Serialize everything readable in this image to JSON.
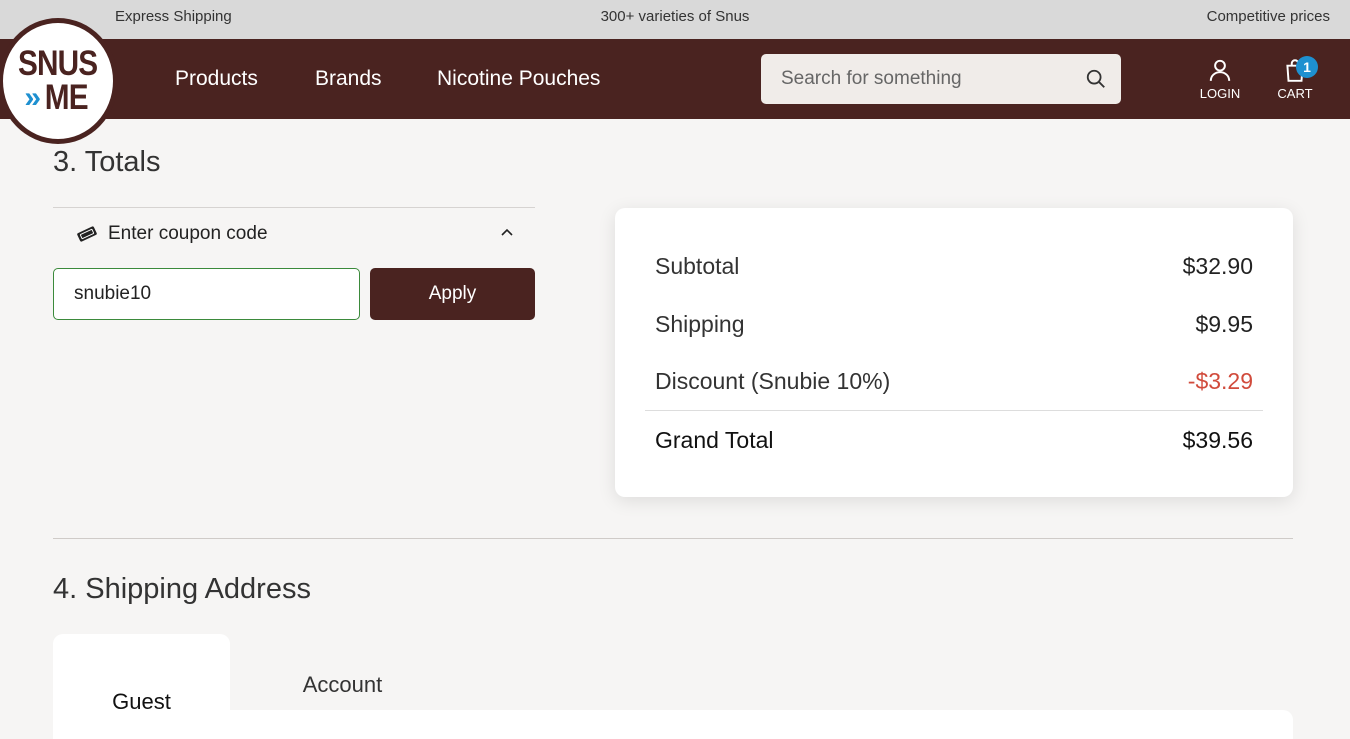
{
  "topbar": {
    "left": "Express Shipping",
    "center": "300+ varieties of Snus",
    "right": "Competitive prices"
  },
  "logo": {
    "line1": "SNUS",
    "chevrons": "»",
    "line2": "ME"
  },
  "nav": {
    "products": "Products",
    "brands": "Brands",
    "pouches": "Nicotine Pouches"
  },
  "search": {
    "placeholder": "Search for something"
  },
  "header_actions": {
    "login": "LOGIN",
    "cart": "CART",
    "cart_count": "1"
  },
  "totals_section": {
    "title": "3. Totals",
    "coupon_label": "Enter coupon code",
    "coupon_value": "snubie10",
    "apply_label": "Apply",
    "rows": {
      "subtotal_label": "Subtotal",
      "subtotal_value": "$32.90",
      "shipping_label": "Shipping",
      "shipping_value": "$9.95",
      "discount_label": "Discount (Snubie 10%)",
      "discount_value": "-$3.29",
      "grand_label": "Grand Total",
      "grand_value": "$39.56"
    }
  },
  "shipping_section": {
    "title": "4. Shipping Address",
    "tabs": {
      "guest": "Guest",
      "account": "Account"
    }
  },
  "colors": {
    "brand": "#4a2320",
    "accent": "#1e90d0",
    "discount": "#d14b3c",
    "input_border": "#3b8a3b"
  }
}
